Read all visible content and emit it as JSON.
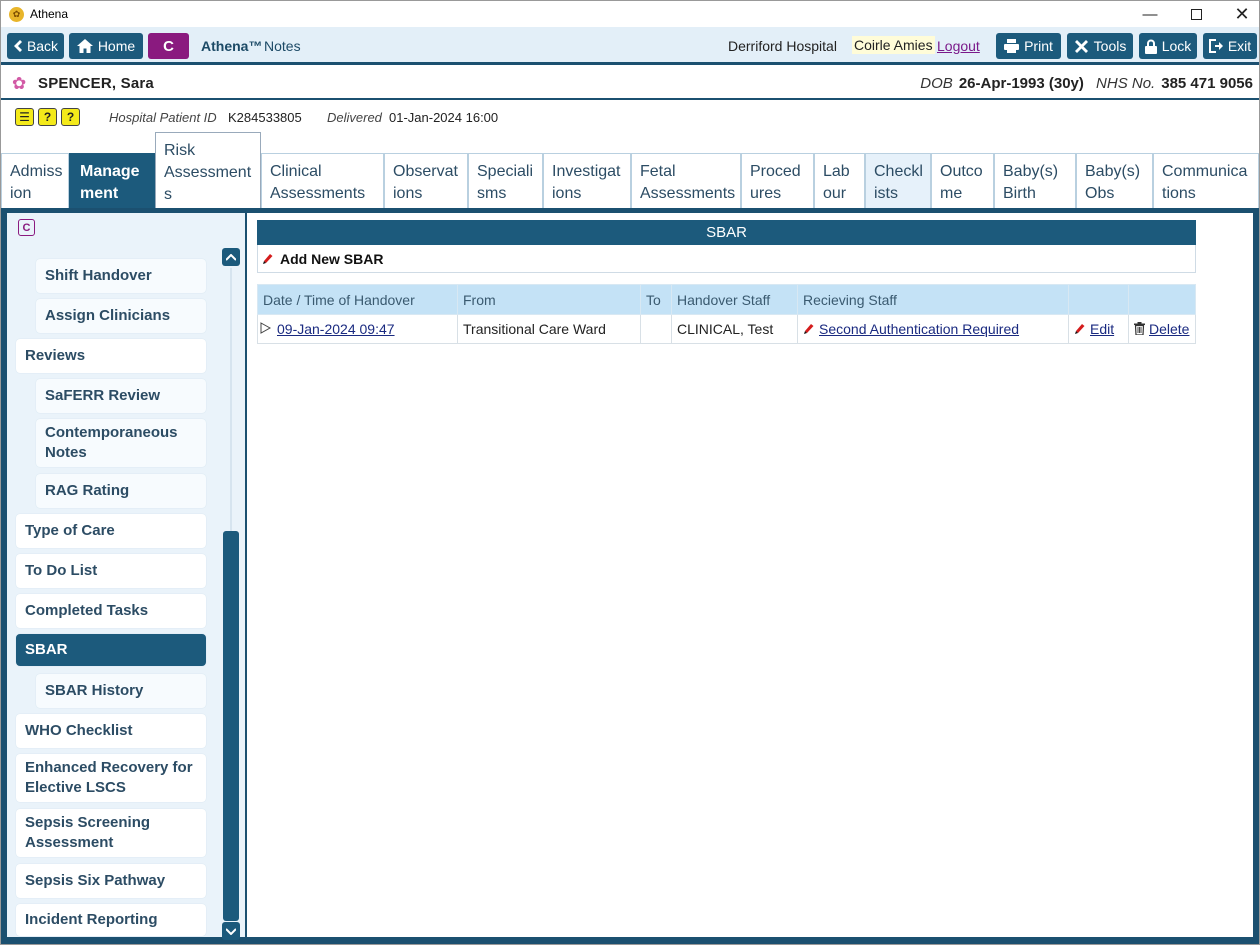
{
  "window": {
    "title": "Athena"
  },
  "toolbar": {
    "back": "Back",
    "home": "Home",
    "c_button": "C",
    "app_name": "Athena™",
    "app_module": "Notes",
    "hospital": "Derriford Hospital",
    "user": "Coirle Amies",
    "logout": "Logout",
    "print": "Print",
    "tools": "Tools",
    "lock": "Lock",
    "exit": "Exit"
  },
  "patient": {
    "name": "SPENCER, Sara",
    "dob_label": "DOB",
    "dob": "26-Apr-1993 (30y)",
    "nhs_label": "NHS No.",
    "nhs": "385 471 9056"
  },
  "info": {
    "hospital_id_label": "Hospital Patient ID",
    "hospital_id": "K284533805",
    "delivered_label": "Delivered",
    "delivered": "01-Jan-2024 16:00"
  },
  "tabs": [
    {
      "line1": "Admiss",
      "line2": "ion"
    },
    {
      "line1": "Manage",
      "line2": "ment"
    },
    {
      "line1": "Risk",
      "line2": "Assessment",
      "line3": "s"
    },
    {
      "line1": "Clinical",
      "line2": "Assessments"
    },
    {
      "line1": "Observat",
      "line2": "ions"
    },
    {
      "line1": "Speciali",
      "line2": "sms"
    },
    {
      "line1": "Investigat",
      "line2": "ions"
    },
    {
      "line1": "Fetal",
      "line2": "Assessments"
    },
    {
      "line1": "Proced",
      "line2": "ures"
    },
    {
      "line1": "Lab",
      "line2": "our"
    },
    {
      "line1": "Checkl",
      "line2": "ists"
    },
    {
      "line1": "Outco",
      "line2": "me"
    },
    {
      "line1": "Baby(s)",
      "line2": "Birth"
    },
    {
      "line1": "Baby(s)",
      "line2": "Obs"
    },
    {
      "line1": "Communica",
      "line2": "tions"
    }
  ],
  "sidebar": {
    "c_mark": "C",
    "items": [
      {
        "label": "Shift Handover"
      },
      {
        "label": "Assign Clinicians"
      },
      {
        "label": "Reviews"
      },
      {
        "label": "SaFERR Review"
      },
      {
        "label": "Contemporaneous Notes"
      },
      {
        "label": "RAG Rating"
      },
      {
        "label": "Type of Care"
      },
      {
        "label": "To Do List"
      },
      {
        "label": "Completed Tasks"
      },
      {
        "label": "SBAR"
      },
      {
        "label": "SBAR History"
      },
      {
        "label": "WHO Checklist"
      },
      {
        "label": "Enhanced Recovery for Elective LSCS"
      },
      {
        "label": "Sepsis Screening Assessment"
      },
      {
        "label": "Sepsis Six Pathway"
      },
      {
        "label": "Incident Reporting"
      }
    ]
  },
  "sbar": {
    "title": "SBAR",
    "add_label": "Add New SBAR",
    "columns": [
      "Date / Time of Handover",
      "From",
      "To",
      "Handover Staff",
      "Recieving Staff",
      "",
      ""
    ],
    "rows": [
      {
        "datetime": "09-Jan-2024 09:47",
        "from": "Transitional Care Ward",
        "to": "",
        "handover_staff": "CLINICAL, Test",
        "receiving_staff": "Second Authentication Required",
        "edit": "Edit",
        "delete": "Delete"
      }
    ]
  }
}
